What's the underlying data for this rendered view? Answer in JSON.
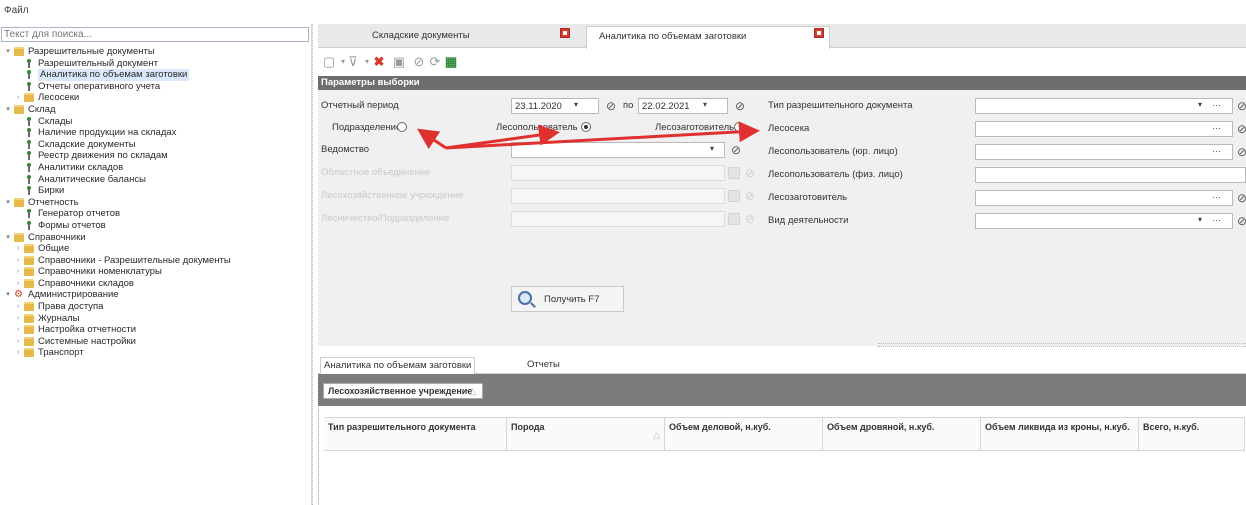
{
  "menu": {
    "file": "Файл"
  },
  "tree": {
    "search_placeholder": "Текст для поиска...",
    "nodes": [
      {
        "label": "Разрешительные документы",
        "level": 0,
        "icon": "folder",
        "toggle": "expanded"
      },
      {
        "label": "Разрешительный документ",
        "level": 1,
        "icon": "pin"
      },
      {
        "label": "Аналитика по объемам заготовки",
        "level": 1,
        "icon": "pin",
        "selected": true
      },
      {
        "label": "Отчеты оперативного учета",
        "level": 1,
        "icon": "pin"
      },
      {
        "label": "Лесосеки",
        "level": 1,
        "icon": "folder",
        "toggle": "collapsed"
      },
      {
        "label": "Склад",
        "level": 0,
        "icon": "folder",
        "toggle": "expanded"
      },
      {
        "label": "Склады",
        "level": 1,
        "icon": "pin"
      },
      {
        "label": "Наличие продукции на складах",
        "level": 1,
        "icon": "pin"
      },
      {
        "label": "Складские документы",
        "level": 1,
        "icon": "pin"
      },
      {
        "label": "Реестр движения по складам",
        "level": 1,
        "icon": "pin"
      },
      {
        "label": "Аналитики складов",
        "level": 1,
        "icon": "pin"
      },
      {
        "label": "Аналитические балансы",
        "level": 1,
        "icon": "pin"
      },
      {
        "label": "Бирки",
        "level": 1,
        "icon": "pin"
      },
      {
        "label": "Отчетность",
        "level": 0,
        "icon": "folder",
        "toggle": "expanded"
      },
      {
        "label": "Генератор отчетов",
        "level": 1,
        "icon": "pin"
      },
      {
        "label": "Формы отчетов",
        "level": 1,
        "icon": "pin"
      },
      {
        "label": "Справочники",
        "level": 0,
        "icon": "folder",
        "toggle": "expanded"
      },
      {
        "label": "Общие",
        "level": 1,
        "icon": "folder",
        "toggle": "collapsed"
      },
      {
        "label": "Справочники - Разрешительные документы",
        "level": 1,
        "icon": "folder",
        "toggle": "collapsed"
      },
      {
        "label": "Справочники номенклатуры",
        "level": 1,
        "icon": "folder",
        "toggle": "collapsed"
      },
      {
        "label": "Справочники складов",
        "level": 1,
        "icon": "folder",
        "toggle": "collapsed"
      },
      {
        "label": "Администрирование",
        "level": 0,
        "icon": "gear",
        "toggle": "expanded"
      },
      {
        "label": "Права доступа",
        "level": 1,
        "icon": "folder",
        "toggle": "collapsed"
      },
      {
        "label": "Журналы",
        "level": 1,
        "icon": "folder",
        "toggle": "collapsed"
      },
      {
        "label": "Настройка отчетности",
        "level": 1,
        "icon": "folder",
        "toggle": "collapsed"
      },
      {
        "label": "Системные настройки",
        "level": 1,
        "icon": "folder",
        "toggle": "collapsed"
      },
      {
        "label": "Транспорт",
        "level": 1,
        "icon": "folder",
        "toggle": "collapsed"
      }
    ]
  },
  "tabs": [
    {
      "label": "Складские документы"
    },
    {
      "label": "Аналитика по объемам заготовки",
      "active": true
    }
  ],
  "params": {
    "header": "Параметры выборки",
    "period_label": "Отчетный период",
    "date_from": "23.11.2020",
    "to_label": "по",
    "date_to": "22.02.2021",
    "radio_subdivision": "Подразделение",
    "radio_user": "Лесопользователь",
    "radio_harvester": "Лесозаготовитель",
    "department_label": "Ведомство",
    "region_label": "Областное объединение",
    "forestry_label": "Лесохозяйственное учреждение",
    "local_forestry_label": "Лесничество/Подразделение",
    "get_button": "Получить F7",
    "permit_type_label": "Тип разрешительного документа",
    "cutting_area_label": "Лесосека",
    "user_legal_label": "Лесопользователь (юр. лицо)",
    "user_person_label": "Лесопользователь (физ. лицо)",
    "harvester_label": "Лесозаготовитель",
    "activity_label": "Вид деятельности"
  },
  "subtabs": [
    {
      "label": "Аналитика по объемам заготовки",
      "active": true
    },
    {
      "label": "Отчеты"
    }
  ],
  "group_chip": "Лесохозяйственное учреждение",
  "columns": [
    "Тип разрешительного документа",
    "Порода",
    "Объем деловой, н.куб.",
    "Объем дровяной, н.куб.",
    "Объем ликвида из кроны, н.куб.",
    "Всего, н.куб."
  ],
  "colors": {
    "accent": "#d63b2f",
    "header_bg": "#6e6e6e",
    "arrow": "#e03030"
  }
}
